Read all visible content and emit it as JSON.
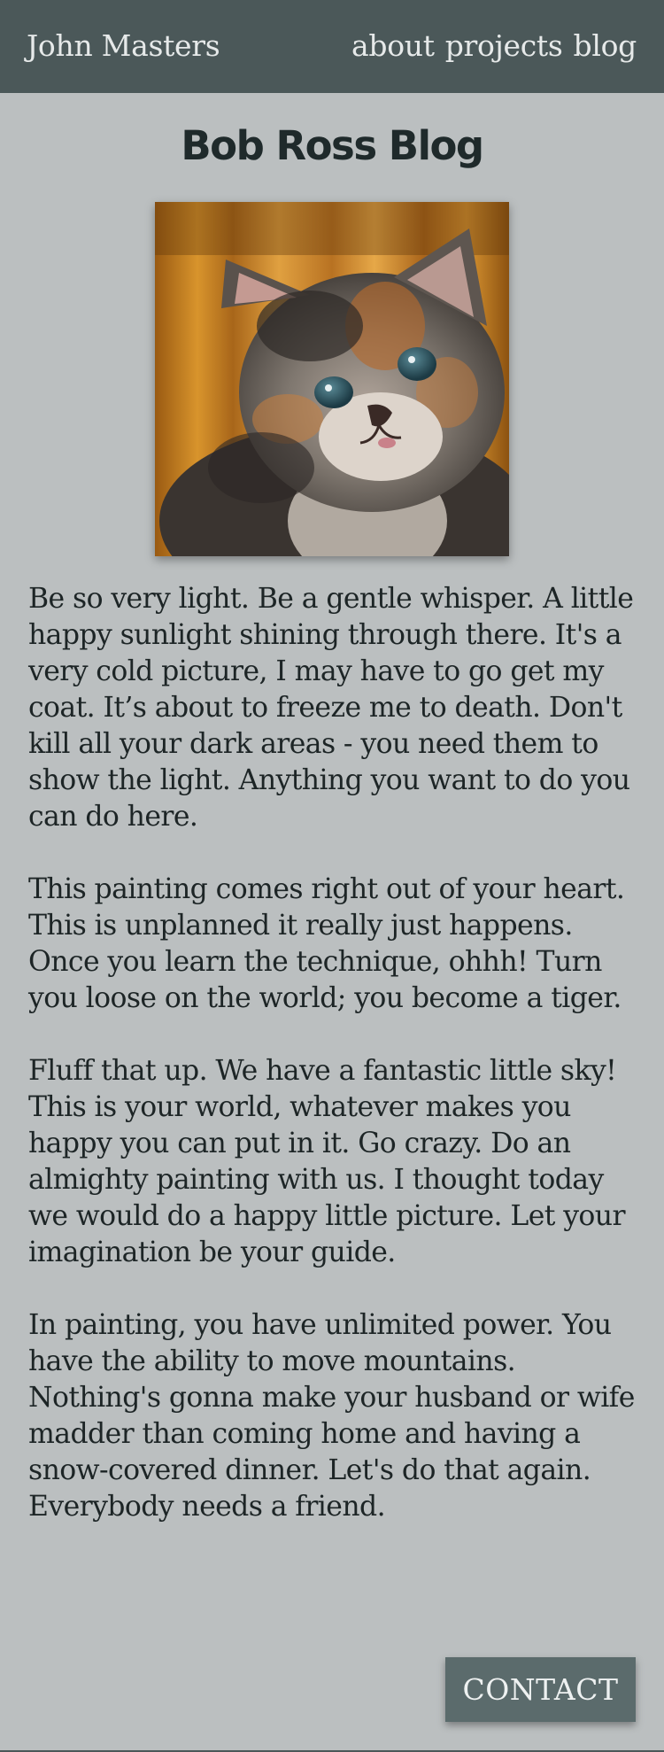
{
  "nav": {
    "brand": "John Masters",
    "links": [
      "about",
      "projects",
      "blog"
    ]
  },
  "page": {
    "title": "Bob Ross Blog"
  },
  "image": {
    "subject": "kitten",
    "alt": "kitten photo"
  },
  "post": {
    "paragraphs": [
      "Be so very light. Be a gentle whisper. A little happy sunlight shining through there. It's a very cold picture, I may have to go get my coat. It’s about to freeze me to death. Don't kill all your dark areas - you need them to show the light. Anything you want to do you can do here.",
      "This painting comes right out of your heart. This is unplanned it really just happens. Once you learn the technique, ohhh! Turn you loose on the world; you become a tiger.",
      "Fluff that up. We have a fantastic little sky! This is your world, whatever makes you happy you can put in it. Go crazy. Do an almighty painting with us. I thought today we would do a happy little picture. Let your imagination be your guide.",
      "In painting, you have unlimited power. You have the ability to move mountains. Nothing's gonna make your husband or wife madder than coming home and having a snow-covered dinner. Let's do that again. Everybody needs a friend."
    ]
  },
  "contact": {
    "label": "CONTACT"
  },
  "colors": {
    "page_background": "#bbbfc0",
    "navbar_background": "#4b5859",
    "nav_text": "#e6e9e9",
    "body_text": "#1d2526",
    "button_background": "#5b6b6c",
    "button_text": "#eef1f1"
  }
}
